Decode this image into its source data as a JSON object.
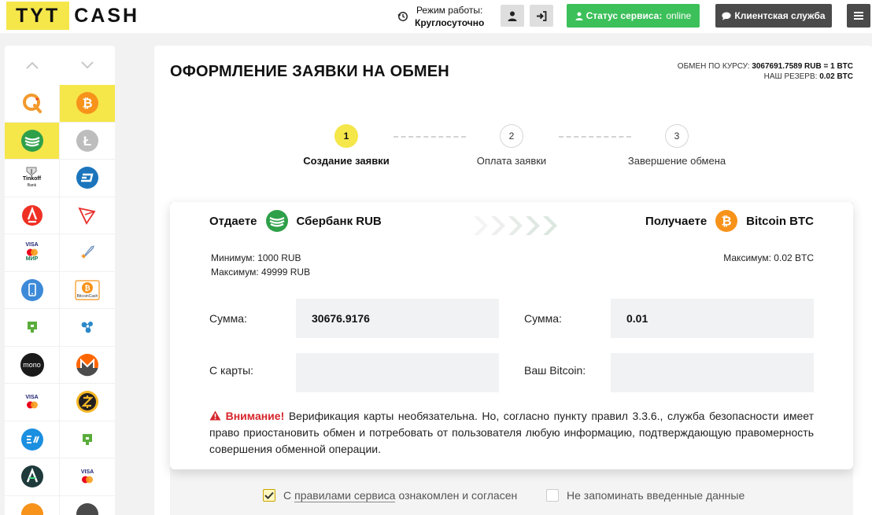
{
  "header": {
    "logo_left": "TYT",
    "logo_right": "CASH",
    "work_mode_label": "Режим работы:",
    "work_mode_value": "Круглосуточно",
    "status_label": "Статус сервиса:",
    "status_value": "online",
    "support_label": "Клиентская служба"
  },
  "main": {
    "title": "ОФОРМЛЕНИЕ ЗАЯВКИ НА ОБМЕН",
    "rate_label": "ОБМЕН ПО КУРСУ:",
    "rate_value": "3067691.7589 RUB = 1 BTC",
    "reserve_label": "НАШ РЕЗЕРВ:",
    "reserve_value": "0.02 BTC",
    "steps": [
      {
        "num": "1",
        "label": "Создание заявки"
      },
      {
        "num": "2",
        "label": "Оплата заявки"
      },
      {
        "num": "3",
        "label": "Завершение обмена"
      }
    ]
  },
  "exchange": {
    "give_label": "Отдаете",
    "give_currency": "Сбербанк RUB",
    "get_label": "Получаете",
    "get_currency": "Bitcoin BTC",
    "min_give": "Минимум: 1000 RUB",
    "max_give": "Максимум: 49999 RUB",
    "max_get": "Максимум: 0.02 BTC",
    "sum_label_give": "Сумма:",
    "sum_value_give": "30676.9176",
    "card_label": "С карты:",
    "card_value": "",
    "sum_label_get": "Сумма:",
    "sum_value_get": "0.01",
    "wallet_label": "Ваш Bitcoin:",
    "wallet_value": "",
    "warning_title": "Внимание!",
    "warning_text": "Верификация карты необязательна. Но, согласно пункту правил 3.3.6., служба безопасности имеет право приостановить обмен и потребовать от пользователя любую информацию, подтверждающую правомерность совершения обменной операции."
  },
  "agreements": {
    "agree_prefix": "С",
    "agree_link": "правилами сервиса",
    "agree_suffix": "ознакомлен и согласен",
    "agree_checked": true,
    "remember_label": "Не запоминать введенные данные",
    "remember_checked": false
  },
  "sidebar": {
    "left_items": [
      "qiwi-icon",
      "sberbank-icon",
      "tinkoff-icon",
      "alfabank-icon",
      "visa-mir-icon",
      "phone-icon",
      "privatbank-icon",
      "monobank-icon",
      "visa-mastercard-icon",
      "exmo-icon",
      "advcash-icon",
      "bitcoin-icon"
    ],
    "right_items": [
      "bitcoin-icon",
      "litecoin-icon",
      "dash-icon",
      "tron-icon",
      "rocket-icon",
      "bitcoin-cash-icon",
      "ripple-icon",
      "monero-icon",
      "zcash-icon",
      "privatbank-icon",
      "visa-mastercard-icon",
      "generic-coin-icon"
    ],
    "tinkoff_text": "Tinkoff",
    "tinkoff_sub": "Bank",
    "mono_text": "mono",
    "bitcoin_cash_text": "BitcoinCash",
    "visa_text": "VISA",
    "mir_text": "МИР"
  },
  "colors": {
    "accent_yellow": "#f5e64a",
    "status_green": "#3cc05a",
    "dark_button": "#4a4a4a",
    "warning_red": "#d6252b",
    "sber_green": "#2fa04a",
    "bitcoin_orange": "#f7931a"
  }
}
